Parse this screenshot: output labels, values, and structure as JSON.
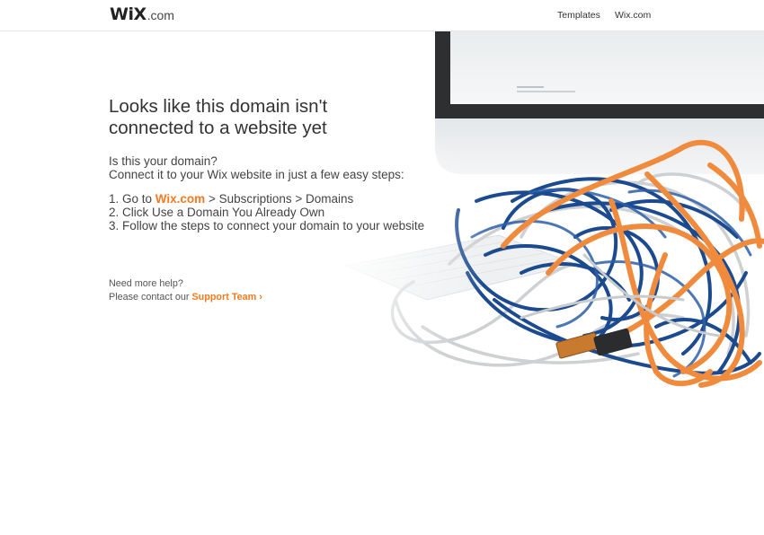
{
  "header": {
    "logo_brand": "WiX",
    "logo_suffix": ".com",
    "nav": {
      "templates": "Templates",
      "wix": "Wix.com"
    }
  },
  "main": {
    "headline_1": "Looks like this domain isn't",
    "headline_2": "connected to a website yet",
    "intro_1": "Is this your domain?",
    "intro_2": "Connect it to your Wix website in just a few easy steps:",
    "step1_prefix": "1. Go to ",
    "step1_link": "Wix.com",
    "step1_suffix": " > Subscriptions > Domains",
    "step2": "2. Click Use a Domain You Already Own",
    "step3": "3. Follow the steps to connect your domain to your website"
  },
  "help": {
    "line1": "Need more help?",
    "line2_prefix": "Please contact our ",
    "support_link": "Support Team ›"
  },
  "colors": {
    "accent": "#f47a20",
    "text": "#3d3d3d"
  },
  "icons": {
    "hero": "tangled-cables-illustration"
  }
}
